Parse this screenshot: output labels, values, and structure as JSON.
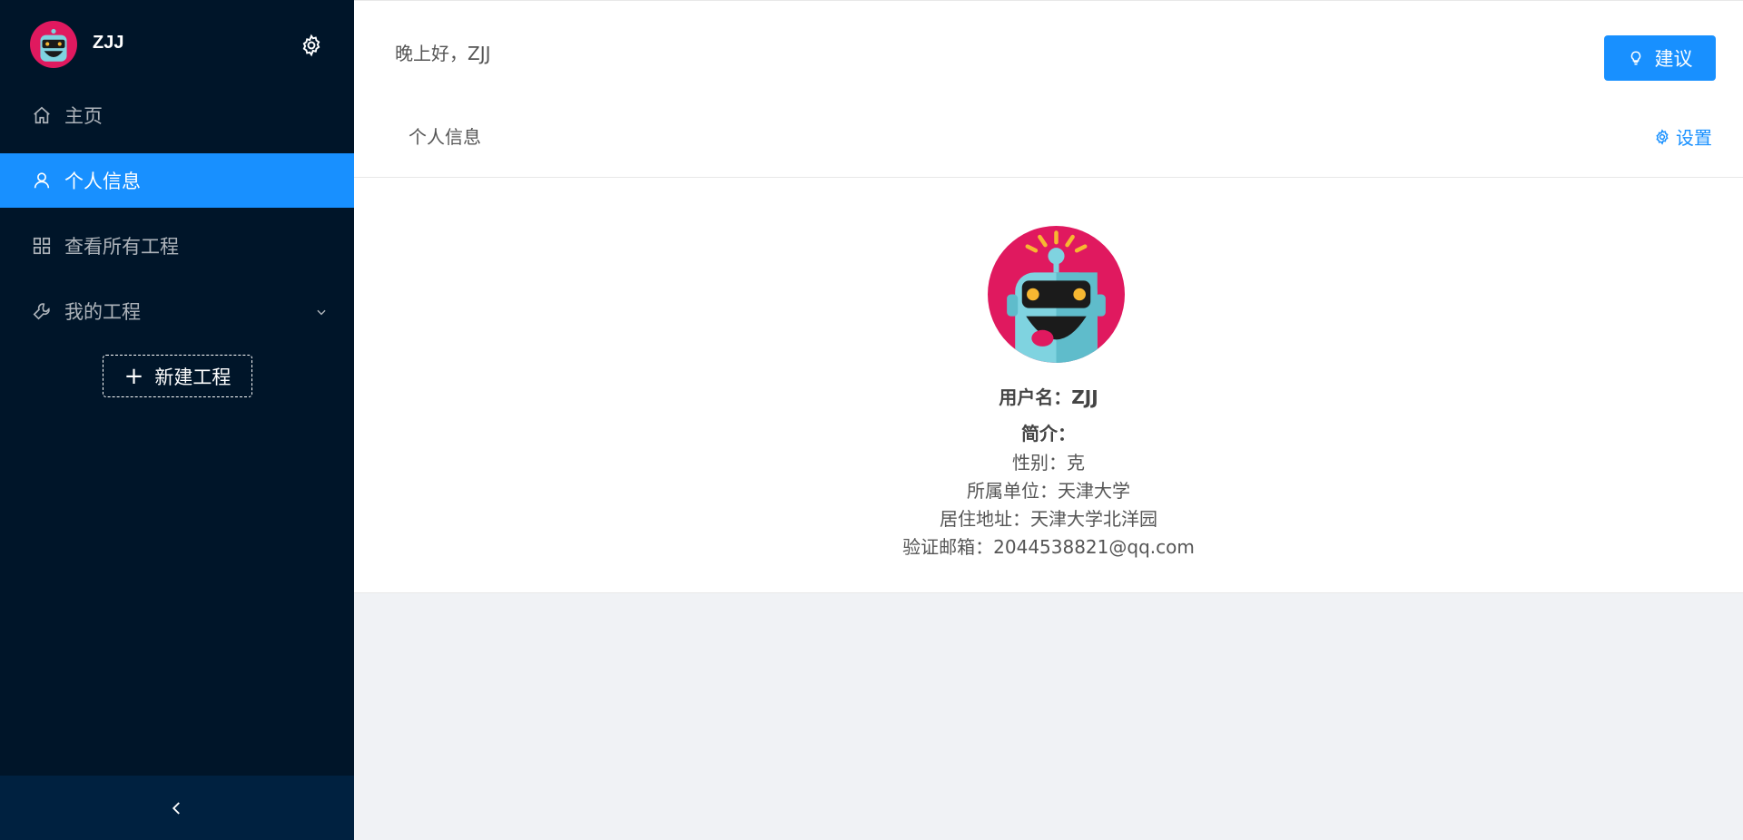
{
  "sidebar": {
    "username": "ZJJ",
    "items": [
      {
        "label": "主页",
        "icon": "home-icon"
      },
      {
        "label": "个人信息",
        "icon": "user-icon",
        "active": true
      },
      {
        "label": "查看所有工程",
        "icon": "grid-icon"
      },
      {
        "label": "我的工程",
        "icon": "wrench-icon",
        "expandable": true
      }
    ],
    "new_button_label": "新建工程"
  },
  "header": {
    "greeting": "晚上好，ZJJ",
    "suggest_label": "建议",
    "tab_label": "个人信息",
    "settings_label": "设置"
  },
  "profile": {
    "username_line": "用户名：ZJJ",
    "intro_label": "简介：",
    "gender": "性别：克",
    "organization": "所属单位：天津大学",
    "address": "居住地址：天津大学北洋园",
    "email": "验证邮箱：2044538821@qq.com"
  },
  "colors": {
    "sidebar_bg": "#001529",
    "accent": "#1890ff",
    "avatar_bg": "#e0195f",
    "robot_face": "#7fd3e0"
  }
}
